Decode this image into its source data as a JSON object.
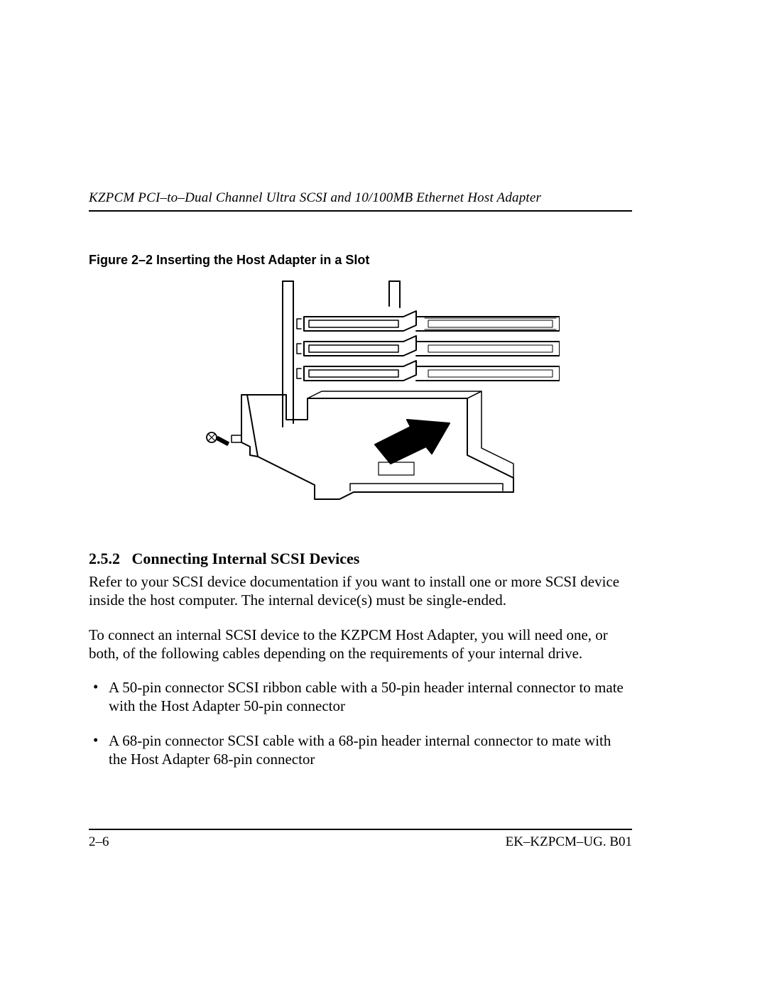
{
  "header": {
    "running_head": "KZPCM PCI–to–Dual Channel Ultra SCSI and 10/100MB Ethernet Host Adapter"
  },
  "figure": {
    "caption": "Figure 2–2  Inserting the Host Adapter in a Slot",
    "alt": "Line drawing of a host adapter card being inserted into a PCI slot at the rear of a computer chassis, with an arrow indicating the insertion direction."
  },
  "section": {
    "number": "2.5.2",
    "title": "Connecting Internal SCSI Devices",
    "para1": "Refer to your SCSI device documentation if you want to install one or more SCSI device inside the host computer. The internal device(s) must be single-ended.",
    "para2": "To connect an internal SCSI device to the KZPCM Host Adapter, you will need one, or both, of the following cables depending on the requirements of your internal drive.",
    "bullets": [
      "A 50-pin connector SCSI ribbon cable with a 50-pin header internal connector to mate with the Host Adapter 50-pin connector",
      "A 68-pin connector SCSI cable with a 68-pin header internal connector to mate with the Host Adapter 68-pin connector"
    ]
  },
  "footer": {
    "page": "2–6",
    "docid": "EK–KZPCM–UG. B01"
  }
}
